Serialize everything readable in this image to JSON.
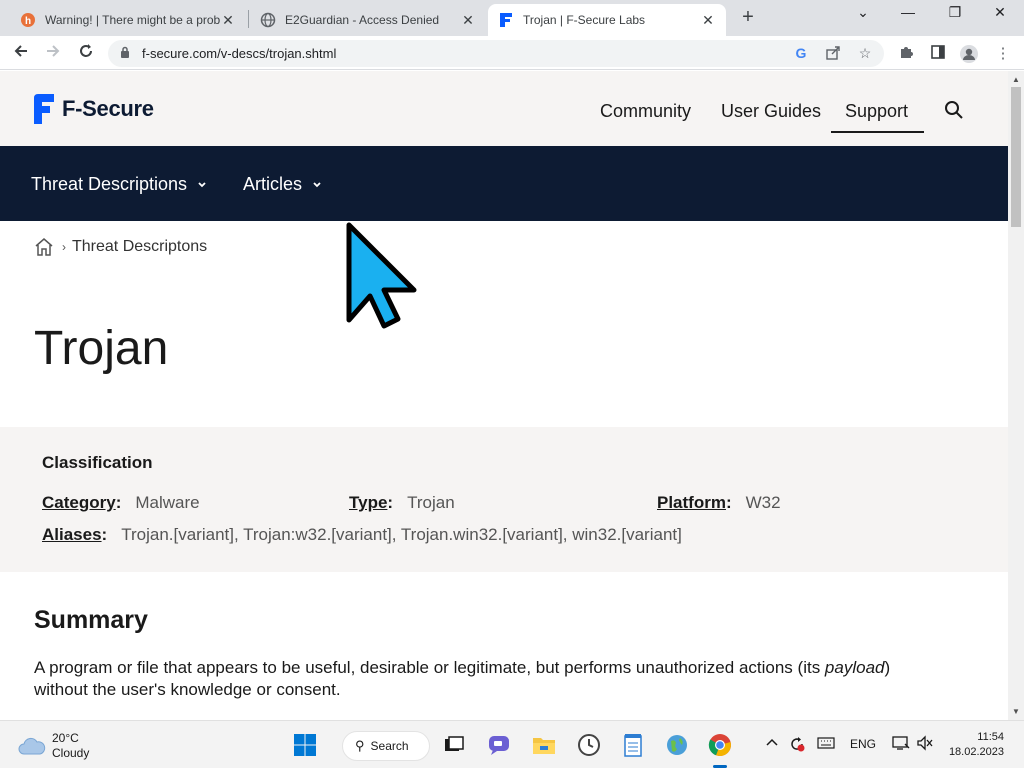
{
  "browser": {
    "tabs": [
      {
        "title": "Warning! | There might be a prob",
        "icon": "warning-favicon",
        "active": false
      },
      {
        "title": "E2Guardian - Access Denied",
        "icon": "globe-favicon",
        "active": false
      },
      {
        "title": "Trojan | F-Secure Labs",
        "icon": "fsecure-favicon",
        "active": true
      }
    ],
    "new_tab_label": "+",
    "url": "f-secure.com/v-descs/trojan.shtml"
  },
  "site": {
    "brand": "F-Secure",
    "brand_color": "#0a5cff",
    "nav": [
      {
        "label": "Community"
      },
      {
        "label": "User Guides"
      },
      {
        "label": "Support",
        "active": true
      }
    ],
    "subnav": [
      {
        "label": "Threat Descriptions"
      },
      {
        "label": "Articles"
      }
    ],
    "subnav_bg": "#0d1b33",
    "breadcrumb": "Threat Descriptons"
  },
  "content": {
    "title": "Trojan",
    "classification": {
      "heading": "Classification",
      "category_label": "Category",
      "category_value": "Malware",
      "type_label": "Type",
      "type_value": "Trojan",
      "platform_label": "Platform",
      "platform_value": "W32",
      "aliases_label": "Aliases",
      "aliases_value": "Trojan.[variant], Trojan:w32.[variant], Trojan.win32.[variant], win32.[variant]"
    },
    "summary_heading": "Summary",
    "summary_text_1": "A program or file that appears to be useful, desirable or legitimate, but performs unauthorized actions (its ",
    "summary_text_em": "payload",
    "summary_text_2": ")",
    "summary_text_3": "without the user's knowledge or consent."
  },
  "taskbar": {
    "weather_temp": "20°C",
    "weather_desc": "Cloudy",
    "search_label": "Search",
    "lang": "ENG",
    "time": "11:54",
    "date": "18.02.2023"
  }
}
